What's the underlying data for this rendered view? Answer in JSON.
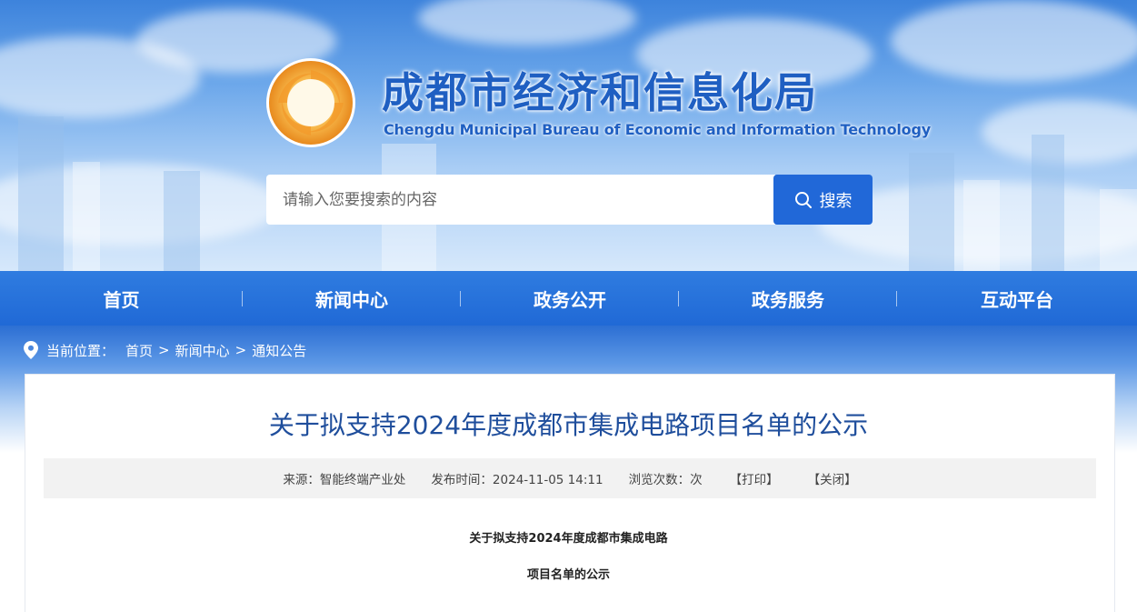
{
  "header": {
    "title": "成都市经济和信息化局",
    "subtitle": "Chengdu Municipal Bureau of Economic and Information Technology"
  },
  "search": {
    "placeholder": "请输入您要搜索的内容",
    "button_label": "搜索"
  },
  "nav": {
    "items": [
      {
        "label": "首页"
      },
      {
        "label": "新闻中心"
      },
      {
        "label": "政务公开"
      },
      {
        "label": "政务服务"
      },
      {
        "label": "互动平台"
      }
    ]
  },
  "breadcrumb": {
    "label": "当前位置：",
    "items": [
      "首页",
      "新闻中心",
      "通知公告"
    ],
    "separator": ">"
  },
  "article": {
    "title": "关于拟支持2024年度成都市集成电路项目名单的公示",
    "meta": {
      "source": "来源：智能终端产业处",
      "published": "发布时间：2024-11-05 14:11",
      "views": "浏览次数：次",
      "print": "【打印】",
      "close": "【关闭】"
    },
    "body": {
      "line1": "关于拟支持2024年度成都市集成电路",
      "line2": "项目名单的公示"
    }
  },
  "colors": {
    "primary": "#2168d8",
    "title_blue": "#1f5fc2",
    "article_title": "#1f4e9c"
  }
}
